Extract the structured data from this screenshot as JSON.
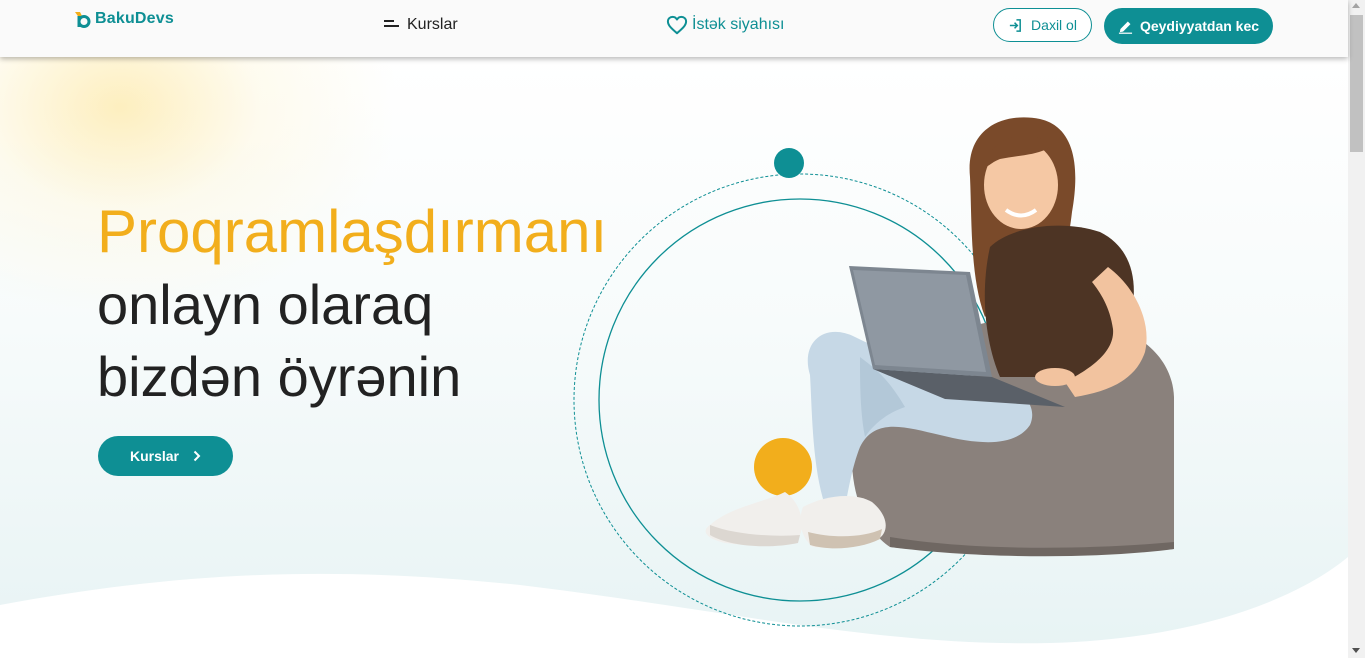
{
  "header": {
    "logo_text": "BakuDevs",
    "nav_courses_label": "Kurslar",
    "nav_wishlist_label": "İstək siyahısı",
    "login_label": "Daxil ol",
    "register_label": "Qeydiyyatdan kec"
  },
  "hero": {
    "headline_line1": "Proqramlaşdırmanı",
    "headline_line2": "onlayn olaraq",
    "headline_line3": "bizdən öyrənin",
    "cta_label": "Kurslar"
  },
  "colors": {
    "brand_teal": "#0e8f94",
    "brand_yellow": "#f2ae1c",
    "text_dark": "#222222"
  },
  "icons": {
    "logo": "bakudevs-logo-icon",
    "nav_courses": "menu-lines-icon",
    "wishlist": "heart-icon",
    "login": "login-arrow-icon",
    "register": "pencil-icon",
    "cta": "chevron-right-icon"
  }
}
